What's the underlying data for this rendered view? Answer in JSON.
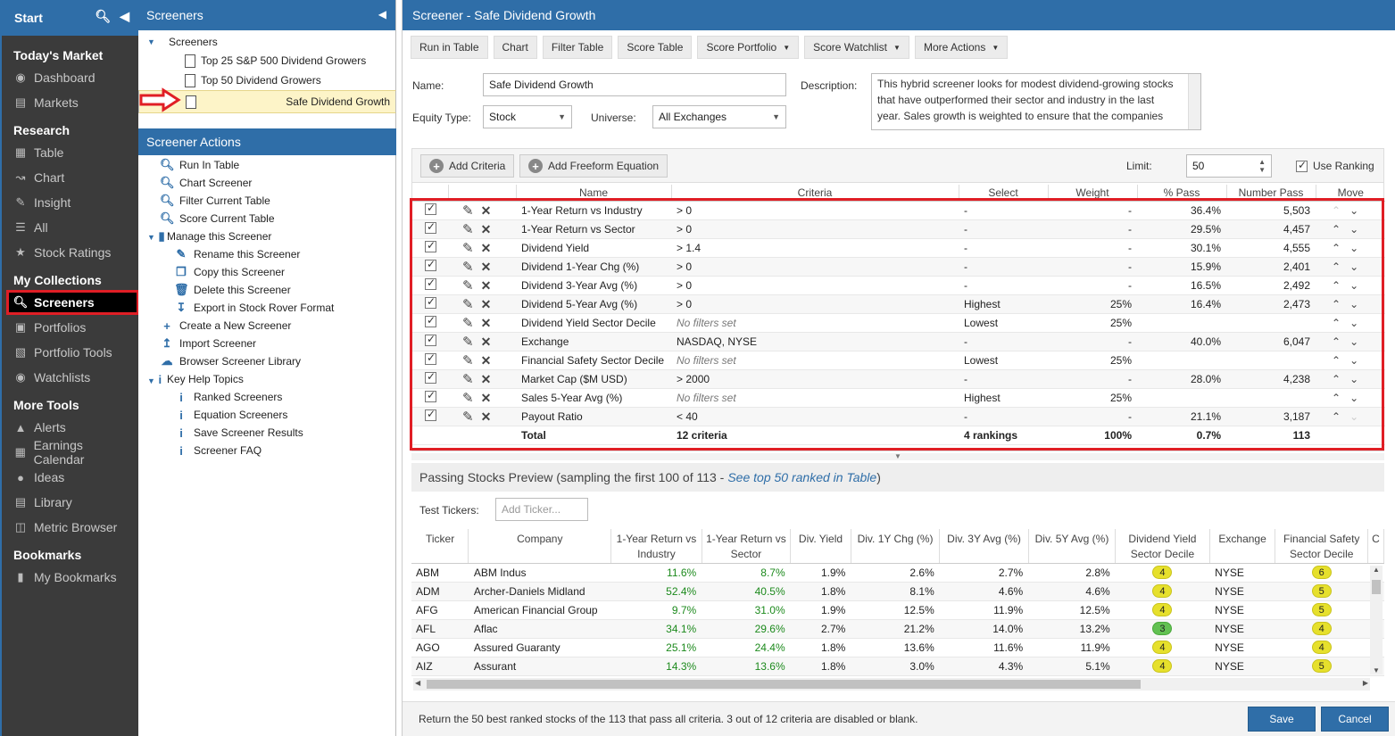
{
  "nav": {
    "start": "Start",
    "sections": [
      {
        "title": "Today's Market",
        "items": [
          {
            "label": "Dashboard",
            "icon": "dashboard-icon"
          },
          {
            "label": "Markets",
            "icon": "markets-icon"
          }
        ]
      },
      {
        "title": "Research",
        "items": [
          {
            "label": "Table",
            "icon": "table-icon"
          },
          {
            "label": "Chart",
            "icon": "chart-icon"
          },
          {
            "label": "Insight",
            "icon": "insight-icon"
          },
          {
            "label": "All",
            "icon": "list-icon"
          },
          {
            "label": "Stock Ratings",
            "icon": "star-icon"
          }
        ]
      },
      {
        "title": "My Collections",
        "items": [
          {
            "label": "Screeners",
            "icon": "search-icon"
          },
          {
            "label": "Portfolios",
            "icon": "briefcase-icon"
          },
          {
            "label": "Portfolio Tools",
            "icon": "bar-chart-icon"
          },
          {
            "label": "Watchlists",
            "icon": "binoculars-icon"
          }
        ]
      },
      {
        "title": "More Tools",
        "items": [
          {
            "label": "Alerts",
            "icon": "bell-icon"
          },
          {
            "label": "Earnings Calendar",
            "icon": "calendar-icon"
          },
          {
            "label": "Ideas",
            "icon": "lightbulb-icon"
          },
          {
            "label": "Library",
            "icon": "book-icon"
          },
          {
            "label": "Metric Browser",
            "icon": "columns-icon"
          }
        ]
      },
      {
        "title": "Bookmarks",
        "items": [
          {
            "label": "My Bookmarks",
            "icon": "bookmark-icon"
          }
        ]
      }
    ]
  },
  "panel": {
    "title": "Screeners",
    "root": "Screeners",
    "screeners": [
      "Top 25 S&P 500 Dividend Growers",
      "Top 50 Dividend Growers",
      "Safe Dividend Growth"
    ],
    "actions_title": "Screener Actions",
    "actions": [
      "Run In Table",
      "Chart Screener",
      "Filter Current Table",
      "Score Current Table"
    ],
    "manage": "Manage this Screener",
    "manage_items": [
      "Rename this Screener",
      "Copy this Screener",
      "Delete this Screener",
      "Export in Stock Rover Format"
    ],
    "more_actions": [
      "Create a New Screener",
      "Import Screener",
      "Browser Screener Library"
    ],
    "help": "Key Help Topics",
    "help_items": [
      "Ranked Screeners",
      "Equation Screeners",
      "Save Screener Results",
      "Screener FAQ"
    ]
  },
  "main": {
    "title": "Screener - Safe Dividend Growth",
    "toolbar": [
      "Run in Table",
      "Chart",
      "Filter Table",
      "Score Table"
    ],
    "toolbar_dd": [
      "Score Portfolio",
      "Score Watchlist",
      "More Actions"
    ],
    "name_label": "Name:",
    "name_value": "Safe Dividend Growth",
    "equity_label": "Equity Type:",
    "equity_value": "Stock",
    "universe_label": "Universe:",
    "universe_value": "All Exchanges",
    "description_label": "Description:",
    "description": "This hybrid screener looks for modest dividend-growing stocks that have outperformed their sector and industry in the last year. Sales growth is weighted to ensure that the companies are",
    "add_criteria": "Add Criteria",
    "add_equation": "Add Freeform Equation",
    "limit_label": "Limit:",
    "limit_value": "50",
    "use_ranking": "Use Ranking"
  },
  "criteria": {
    "headers": [
      "Name",
      "Criteria",
      "Select",
      "Weight",
      "% Pass",
      "Number Pass",
      "Move"
    ],
    "rows": [
      {
        "name": "1-Year Return vs Industry",
        "criteria": "> 0",
        "select": "-",
        "weight": "-",
        "pass": "36.4%",
        "num": "5,503"
      },
      {
        "name": "1-Year Return vs Sector",
        "criteria": "> 0",
        "select": "-",
        "weight": "-",
        "pass": "29.5%",
        "num": "4,457"
      },
      {
        "name": "Dividend Yield",
        "criteria": "> 1.4",
        "select": "-",
        "weight": "-",
        "pass": "30.1%",
        "num": "4,555"
      },
      {
        "name": "Dividend 1-Year Chg (%)",
        "criteria": "> 0",
        "select": "-",
        "weight": "-",
        "pass": "15.9%",
        "num": "2,401"
      },
      {
        "name": "Dividend 3-Year Avg (%)",
        "criteria": "> 0",
        "select": "-",
        "weight": "-",
        "pass": "16.5%",
        "num": "2,492"
      },
      {
        "name": "Dividend 5-Year Avg (%)",
        "criteria": "> 0",
        "select": "Highest",
        "weight": "25%",
        "pass": "16.4%",
        "num": "2,473"
      },
      {
        "name": "Dividend Yield Sector Decile",
        "criteria": "No filters set",
        "select": "Lowest",
        "weight": "25%",
        "pass": "",
        "num": ""
      },
      {
        "name": "Exchange",
        "criteria": "NASDAQ, NYSE",
        "select": "-",
        "weight": "-",
        "pass": "40.0%",
        "num": "6,047"
      },
      {
        "name": "Financial Safety Sector Decile",
        "criteria": "No filters set",
        "select": "Lowest",
        "weight": "25%",
        "pass": "",
        "num": ""
      },
      {
        "name": "Market Cap ($M USD)",
        "criteria": "> 2000",
        "select": "-",
        "weight": "-",
        "pass": "28.0%",
        "num": "4,238"
      },
      {
        "name": "Sales 5-Year Avg (%)",
        "criteria": "No filters set",
        "select": "Highest",
        "weight": "25%",
        "pass": "",
        "num": ""
      },
      {
        "name": "Payout Ratio",
        "criteria": "< 40",
        "select": "-",
        "weight": "-",
        "pass": "21.1%",
        "num": "3,187"
      }
    ],
    "total": {
      "name": "Total",
      "criteria": "12 criteria",
      "select": "4 rankings",
      "weight": "100%",
      "pass": "0.7%",
      "num": "113"
    }
  },
  "preview": {
    "title": "Passing Stocks Preview (sampling the first 100 of 113 -",
    "link": "See top 50 ranked in Table",
    "close_paren": ")",
    "test_label": "Test Tickers:",
    "test_placeholder": "Add Ticker...",
    "headers": [
      "Ticker",
      "Company",
      "1-Year Return vs Industry",
      "1-Year Return vs Sector",
      "Div. Yield",
      "Div. 1Y Chg (%)",
      "Div. 3Y Avg (%)",
      "Div. 5Y Avg (%)",
      "Dividend Yield Sector Decile",
      "Exchange",
      "Financial Safety Sector Decile",
      "C"
    ],
    "rows": [
      {
        "ticker": "ABM",
        "company": "ABM Indus",
        "r1": "11.6%",
        "r2": "8.7%",
        "dy": "1.9%",
        "d1": "2.6%",
        "d3": "2.7%",
        "d5": "2.8%",
        "dyd": "4",
        "ex": "NYSE",
        "fsd": "6"
      },
      {
        "ticker": "ADM",
        "company": "Archer-Daniels Midland",
        "r1": "52.4%",
        "r2": "40.5%",
        "dy": "1.8%",
        "d1": "8.1%",
        "d3": "4.6%",
        "d5": "4.6%",
        "dyd": "4",
        "ex": "NYSE",
        "fsd": "5"
      },
      {
        "ticker": "AFG",
        "company": "American Financial Group",
        "r1": "9.7%",
        "r2": "31.0%",
        "dy": "1.9%",
        "d1": "12.5%",
        "d3": "11.9%",
        "d5": "12.5%",
        "dyd": "4",
        "ex": "NYSE",
        "fsd": "5"
      },
      {
        "ticker": "AFL",
        "company": "Aflac",
        "r1": "34.1%",
        "r2": "29.6%",
        "dy": "2.7%",
        "d1": "21.2%",
        "d3": "14.0%",
        "d5": "13.2%",
        "dyd": "3",
        "ex": "NYSE",
        "fsd": "4"
      },
      {
        "ticker": "AGO",
        "company": "Assured Guaranty",
        "r1": "25.1%",
        "r2": "24.4%",
        "dy": "1.8%",
        "d1": "13.6%",
        "d3": "11.6%",
        "d5": "11.9%",
        "dyd": "4",
        "ex": "NYSE",
        "fsd": "4"
      },
      {
        "ticker": "AIZ",
        "company": "Assurant",
        "r1": "14.3%",
        "r2": "13.6%",
        "dy": "1.8%",
        "d1": "3.0%",
        "d3": "4.3%",
        "d5": "5.1%",
        "dyd": "4",
        "ex": "NYSE",
        "fsd": "5"
      }
    ]
  },
  "footer": {
    "text": "Return the 50 best ranked stocks of the 113 that pass all criteria. 3 out of 12 criteria are disabled or blank.",
    "save": "Save",
    "cancel": "Cancel"
  }
}
